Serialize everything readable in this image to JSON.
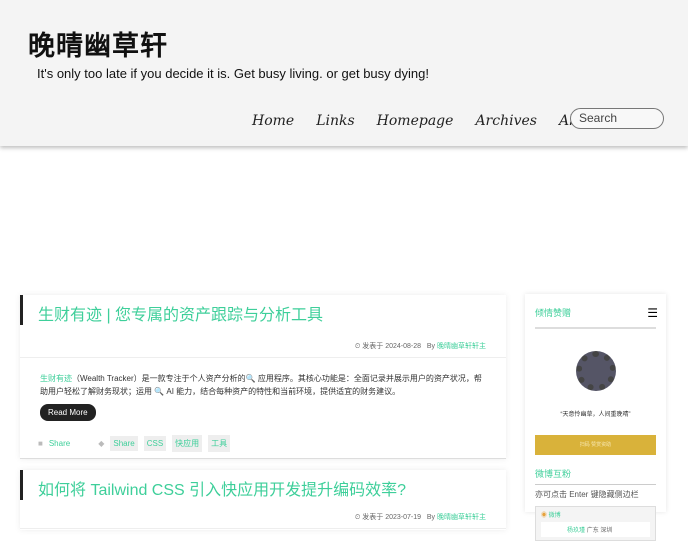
{
  "site": {
    "logo": "晚晴幽草轩",
    "tagline": "It's only too late if you decide it is. Get busy living. or get busy dying!",
    "nav": [
      "Home",
      "Links",
      "Homepage",
      "Archives",
      "About"
    ],
    "search_placeholder": "Search"
  },
  "posts": [
    {
      "title": "生财有迹 | 您专属的资产跟踪与分析工具",
      "date_prefix": "发表于 2024-08-28",
      "by": "By",
      "author": "晚晴幽草轩轩主",
      "excerpt_link": "生财有迹",
      "excerpt": "（Wealth Tracker）是一款专注于个人资产分析的🔍 应用程序。其核心功能是：全面记录并展示用户的资产状况，帮助用户轻松了解财务现状；运用 🔍 AI 能力，结合每种资产的特性和当前环境，提供适宜的财务建议。",
      "read_more": "Read More",
      "category": "Share",
      "tags": [
        "Share",
        "CSS",
        "快应用",
        "工具"
      ]
    },
    {
      "title": "如何将 Tailwind CSS 引入快应用开发提升编码效率?",
      "date_prefix": "发表于 2023-07-19",
      "by": "By",
      "author": "晚晴幽草轩轩主"
    }
  ],
  "sidebar": {
    "donate_title": "倾情赞赠",
    "quote": "“天意怜幽草，人间重晚晴”",
    "donate_caption": "扫码 赞赏资助",
    "weibo_title": "微博互粉",
    "hint": "亦可点击 Enter 键隐藏侧边栏",
    "weibo_label": "微博",
    "weibo_user": "杨玖瑾",
    "weibo_loc": "广东 深圳"
  }
}
